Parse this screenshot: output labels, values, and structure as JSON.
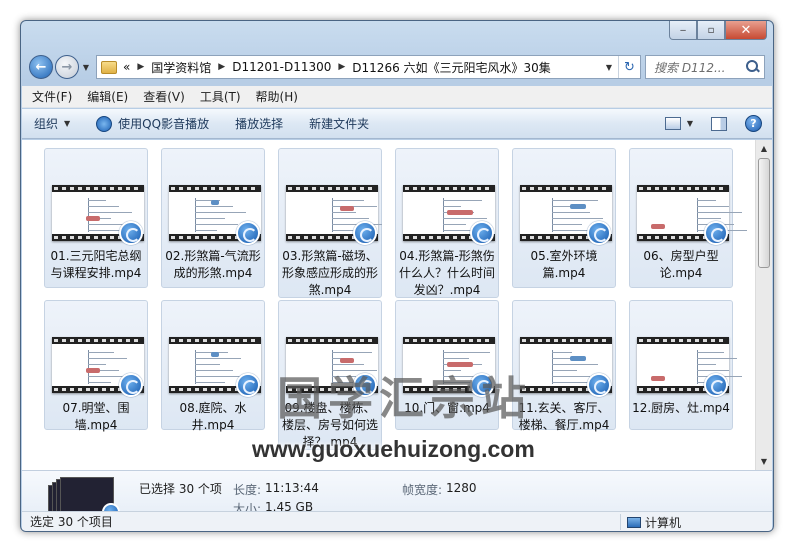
{
  "window": {
    "minimize_glyph": "‒",
    "maximize_glyph": "▫",
    "close_glyph": "✕"
  },
  "address": {
    "overflow": "«",
    "parts": [
      "国学资料馆",
      "D11201-D11300",
      "D11266 六如《三元阳宅风水》30集"
    ],
    "search_placeholder": "搜索 D112..."
  },
  "menu": [
    "文件(F)",
    "编辑(E)",
    "查看(V)",
    "工具(T)",
    "帮助(H)"
  ],
  "toolbar": {
    "organize": "组织",
    "play_qq": "使用QQ影音播放",
    "play_selected": "播放选择",
    "new_folder": "新建文件夹",
    "help": "?"
  },
  "files": [
    {
      "name": "01.三元阳宅总纲与课程安排.mp4"
    },
    {
      "name": "02.形煞篇-气流形成的形煞.mp4"
    },
    {
      "name": "03.形煞篇-磁场、形象感应形成的形煞.mp4"
    },
    {
      "name": "04.形煞篇-形煞伤什么人？什么时间发凶？.mp4"
    },
    {
      "name": "05.室外环境篇.mp4"
    },
    {
      "name": "06、房型户型论.mp4"
    },
    {
      "name": "07.明堂、围墙.mp4"
    },
    {
      "name": "08.庭院、水井.mp4"
    },
    {
      "name": "09.楼盘、楼栋、楼层、房号如何选择？.mp4"
    },
    {
      "name": "10.门、窗.mp4"
    },
    {
      "name": "11.玄关、客厅、楼梯、餐厅.mp4"
    },
    {
      "name": "12.厨房、灶.mp4"
    }
  ],
  "watermark": {
    "title": "国学汇宗站",
    "url": "www.guoxuehuizong.com"
  },
  "details": {
    "selected": "已选择 30 个项",
    "length_label": "长度:",
    "length_value": "11:13:44",
    "width_label": "帧宽度:",
    "width_value": "1280",
    "size_label": "大小:",
    "size_value": "1.45 GB"
  },
  "status": {
    "left": "选定 30 个项目",
    "right": "计算机"
  }
}
